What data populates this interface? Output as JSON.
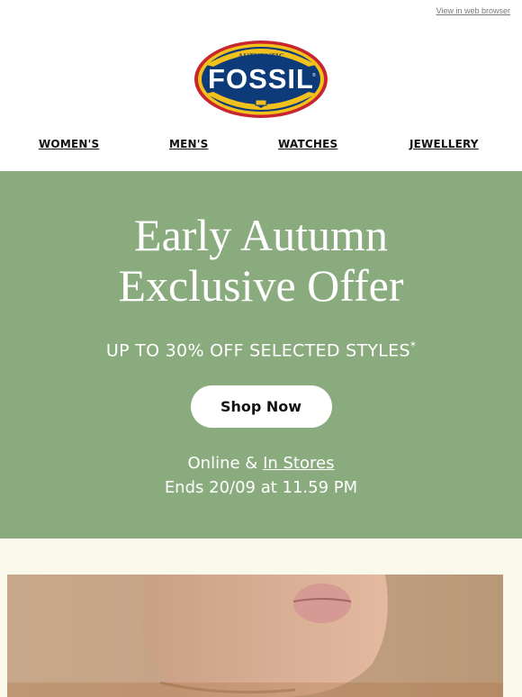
{
  "topbar": {
    "web_view_link": "View in web browser"
  },
  "logo": {
    "top_text": "AUTHENTIC",
    "brand": "FOSSIL"
  },
  "nav": {
    "items": [
      "WOMEN'S",
      "MEN'S",
      "WATCHES",
      "JEWELLERY"
    ]
  },
  "hero": {
    "title_line1": "Early Autumn",
    "title_line2": "Exclusive Offer",
    "subtitle": "UP TO 30% OFF SELECTED STYLES",
    "subtitle_mark": "*",
    "button_label": "Shop Now",
    "availability_prefix": "Online & ",
    "availability_link": "In Stores",
    "ends": "Ends 20/09 at 11.59 PM"
  },
  "colors": {
    "hero_bg": "#8aab7d",
    "cream_bg": "#fbf8ec",
    "logo_blue": "#0d3a78",
    "logo_yellow": "#f3c11b",
    "logo_red": "#c8252f"
  }
}
